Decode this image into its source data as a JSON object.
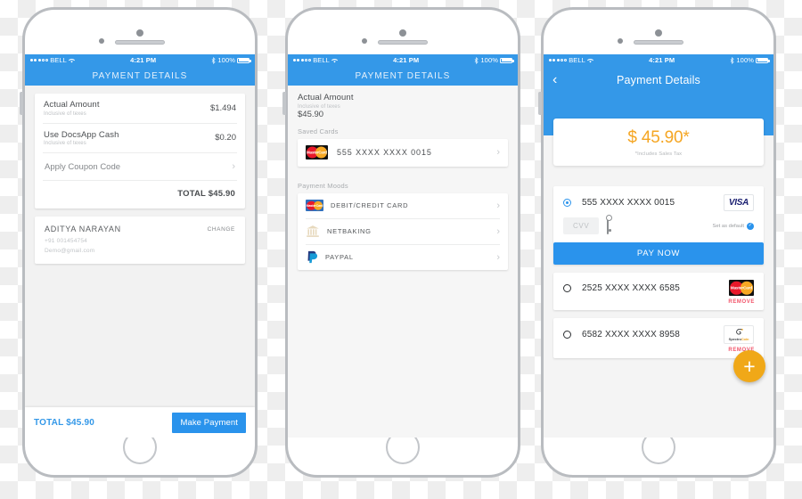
{
  "statusbar": {
    "carrier": "BELL",
    "time": "4:21 PM",
    "battery_pct": "100%",
    "wifi_icon": "wifi-icon",
    "bluetooth_icon": "bluetooth-icon"
  },
  "colors": {
    "brand_blue": "#3498e8",
    "button_blue": "#2a93ec",
    "amount_orange": "#f5a623",
    "fab_orange": "#f0a818",
    "remove_red": "#f2556a"
  },
  "screen1": {
    "nav_title": "PAYMENT DETAILS",
    "rows": [
      {
        "title": "Actual Amount",
        "sub": "Inclusive of texes",
        "value": "$1.494"
      },
      {
        "title": "Use DocsApp Cash",
        "sub": "Inclusive of texes",
        "value": "$0.20"
      }
    ],
    "coupon_label": "Apply Coupon Code",
    "total_label": "TOTAL $45.90",
    "user": {
      "name": "ADITYA NARAYAN",
      "change_label": "CHANGE",
      "phone": "+91 001454754",
      "email": "Demo@gmail.com"
    },
    "footer": {
      "total": "TOTAL $45.90",
      "button": "Make Payment"
    }
  },
  "screen2": {
    "nav_title": "PAYMENT DETAILS",
    "amount": {
      "title": "Actual Amount",
      "sub": "Inclusive of texes",
      "value": "$45.90"
    },
    "saved_cards_label": "Saved Cards",
    "saved_cards": [
      {
        "number": "555 XXXX XXXX 0015",
        "brand": "mastercard-logo"
      }
    ],
    "payment_modes_label": "Payment Moods",
    "payment_modes": [
      {
        "label": "DEBIT/CREDIT CARD",
        "icon": "mastercard-logo"
      },
      {
        "label": "NETBAKING",
        "icon": "bank-icon"
      },
      {
        "label": "PAYPAL",
        "icon": "paypal-icon"
      }
    ]
  },
  "screen3": {
    "nav_title": "Payment Details",
    "back_icon": "chevron-left-icon",
    "hero": {
      "amount": "$ 45.90*",
      "note": "*Includes Sales Tax"
    },
    "selected_card": {
      "number": "555 XXXX XXXX 0015",
      "brand": "visa-logo",
      "brand_text": "VISA",
      "cvv_placeholder": "CVV",
      "set_default_label": "Set as default",
      "pay_button": "PAY NOW"
    },
    "other_cards": [
      {
        "number": "2525 XXXX XXXX 6585",
        "brand": "mastercard-logo",
        "remove_label": "REMOVE"
      },
      {
        "number": "6582 XXXX XXXX 8958",
        "brand": "spectrocoin-logo",
        "brand_text_a": "Spectro",
        "brand_text_b": "Coin",
        "remove_label": "REMOVE"
      }
    ],
    "fab_label": "+"
  }
}
